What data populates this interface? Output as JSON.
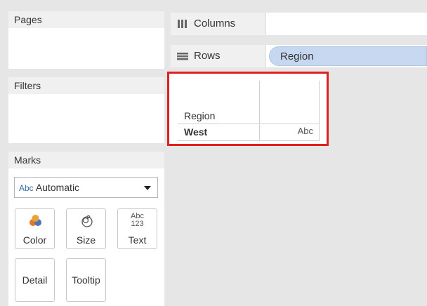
{
  "cards": {
    "pages": {
      "title": "Pages"
    },
    "filters": {
      "title": "Filters"
    },
    "marks": {
      "title": "Marks",
      "mark_type": {
        "prefix": "Abc",
        "value": "Automatic"
      },
      "buttons": [
        {
          "label": "Color",
          "icon": "color-icon"
        },
        {
          "label": "Size",
          "icon": "size-icon"
        },
        {
          "label": "Text",
          "icon": "text-icon",
          "icon_text_top": "Abc",
          "icon_text_bottom": "123"
        },
        {
          "label": "Detail",
          "icon": "detail-icon"
        },
        {
          "label": "Tooltip",
          "icon": "tooltip-icon"
        }
      ]
    }
  },
  "shelves": {
    "columns": {
      "label": "Columns",
      "icon": "columns-icon",
      "pills": []
    },
    "rows": {
      "label": "Rows",
      "icon": "rows-icon",
      "pills": [
        "Region"
      ]
    }
  },
  "view": {
    "row_header": "Region",
    "rows": [
      {
        "label": "West",
        "value": "Abc"
      }
    ]
  },
  "colors": {
    "pill": "#c6d8ef",
    "highlight_border": "#e02020",
    "color_icon": [
      "#e87722",
      "#4a76b8",
      "#e8a33c"
    ]
  }
}
